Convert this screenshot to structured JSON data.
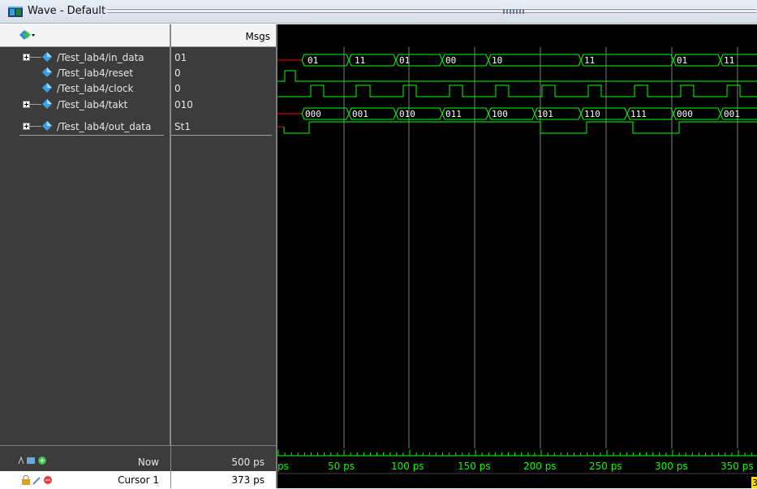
{
  "window": {
    "title": "Wave - Default"
  },
  "header": {
    "msgs_label": "Msgs"
  },
  "signals": [
    {
      "name": "/Test_lab4/in_data",
      "value": "01",
      "expandable": true
    },
    {
      "name": "/Test_lab4/reset",
      "value": "0",
      "expandable": false
    },
    {
      "name": "/Test_lab4/clock",
      "value": "0",
      "expandable": false
    },
    {
      "name": "/Test_lab4/takt",
      "value": "010",
      "expandable": true
    },
    {
      "name": "/Test_lab4/out_data",
      "value": "St1",
      "expandable": true
    }
  ],
  "waves": {
    "in_data_labels": [
      "01",
      "11",
      "01",
      "00",
      "10",
      "11",
      "01",
      "11"
    ],
    "takt_labels": [
      "000",
      "001",
      "010",
      "011",
      "100",
      "101",
      "110",
      "111",
      "000",
      "001"
    ]
  },
  "timeline": {
    "now_label": "Now",
    "now_value": "500 ps",
    "cursor_label": "Cursor 1",
    "cursor_value": "373 ps",
    "tick_labels": [
      "ps",
      "50 ps",
      "100 ps",
      "150 ps",
      "200 ps",
      "250 ps",
      "300 ps",
      "350 ps"
    ],
    "cursor_flag_fragment": "3"
  },
  "colors": {
    "wave_green": "#00ff00",
    "value_red": "#ff0000",
    "cursor_yellow": "#ffd800",
    "grid_gray": "#808080"
  },
  "icons": [
    "app-window-icon",
    "wave-color-icon",
    "signal-diamond-icon",
    "add-cursor-icon",
    "lock-icon",
    "delete-cursor-icon"
  ]
}
